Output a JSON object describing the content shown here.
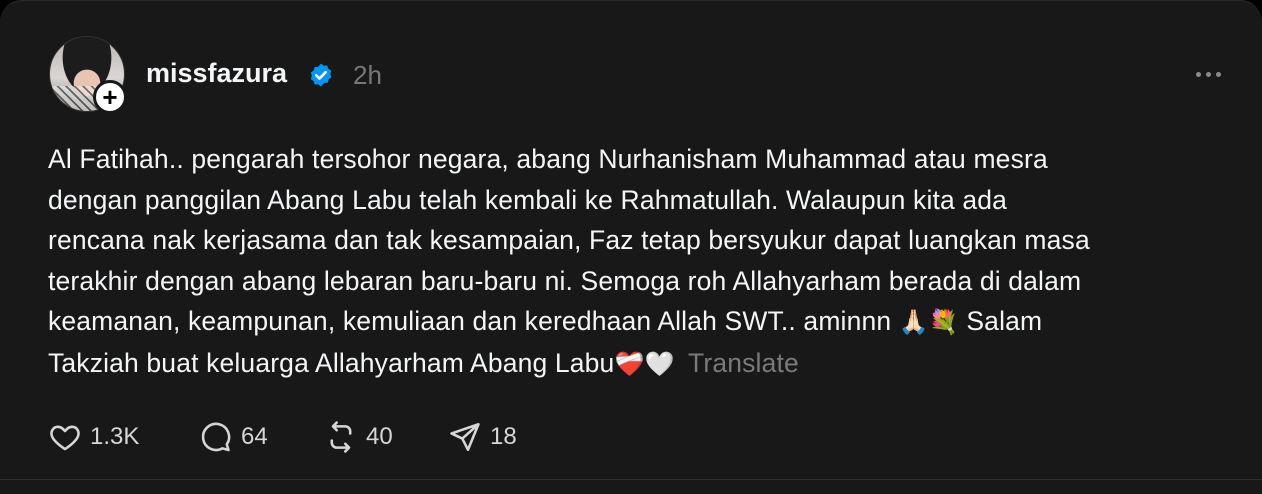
{
  "post": {
    "username": "missfazura",
    "time": "2h",
    "follow_symbol": "+",
    "verified_icon": "verified-badge-icon",
    "text_lines": [
      "Al Fatihah.. pengarah tersohor negara, abang Nurhanisham Muhammad atau mesra",
      "dengan panggilan Abang Labu telah kembali ke Rahmatullah. Walaupun kita ada",
      "rencana nak kerjasama dan tak kesampaian, Faz tetap bersyukur dapat luangkan masa",
      "terakhir dengan abang lebaran baru-baru ni. Semoga roh Allahyarham berada di dalam",
      "keamanan, keampunan, kemuliaan dan keredhaan Allah SWT.. aminnn",
      "Salam",
      "Takziah buat keluarga Allahyarham Abang Labu"
    ],
    "emojis": {
      "line5": "🙏🏻💐",
      "line6": "❤️‍🩹🤍"
    },
    "translate_label": "Translate"
  },
  "actions": {
    "likes": "1.3K",
    "comments": "64",
    "reposts": "40",
    "shares": "18"
  },
  "colors": {
    "background": "#181818",
    "text": "#f3f5f7",
    "muted": "#777777",
    "verified": "#0095f6"
  }
}
